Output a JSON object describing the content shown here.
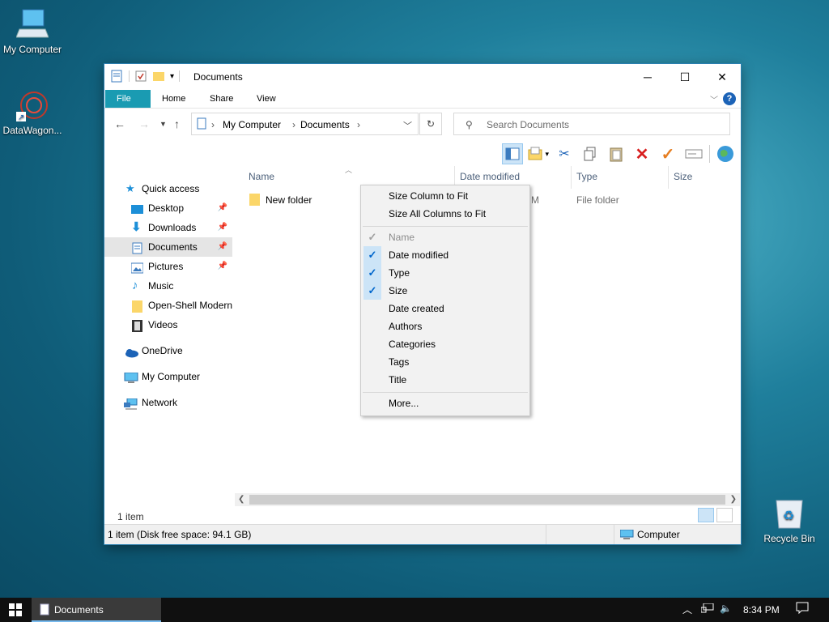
{
  "desktop": {
    "icons": [
      {
        "label": "My Computer"
      },
      {
        "label": "DataWagon..."
      },
      {
        "label": "Recycle Bin"
      }
    ]
  },
  "window": {
    "title": "Documents",
    "ribbon_tabs": [
      "File",
      "Home",
      "Share",
      "View"
    ],
    "help_label": "?",
    "breadcrumb": [
      "My Computer",
      "Documents"
    ],
    "search_placeholder": "Search Documents",
    "columns": {
      "name": "Name",
      "date_modified": "Date modified",
      "type": "Type",
      "size": "Size"
    },
    "files": [
      {
        "name": "New folder",
        "date_fragment": "M",
        "type": "File folder"
      }
    ],
    "nav": {
      "quick_access": "Quick access",
      "items": [
        {
          "label": "Desktop",
          "pinned": true
        },
        {
          "label": "Downloads",
          "pinned": true
        },
        {
          "label": "Documents",
          "pinned": true,
          "active": true
        },
        {
          "label": "Pictures",
          "pinned": true
        },
        {
          "label": "Music",
          "pinned": false
        },
        {
          "label": "Open-Shell Modern",
          "pinned": false
        },
        {
          "label": "Videos",
          "pinned": false
        }
      ],
      "onedrive": "OneDrive",
      "my_computer": "My Computer",
      "network": "Network"
    },
    "item_count": "1 item",
    "status_left": "1 item (Disk free space: 94.1 GB)",
    "status_right": "Computer"
  },
  "context_menu": {
    "items": [
      {
        "label": "Size Column to Fit"
      },
      {
        "label": "Size All Columns to Fit"
      },
      {
        "label": "Name",
        "checked": true,
        "disabled": true
      },
      {
        "label": "Date modified",
        "checked": true
      },
      {
        "label": "Type",
        "checked": true
      },
      {
        "label": "Size",
        "checked": true
      },
      {
        "label": "Date created",
        "checked": false
      },
      {
        "label": "Authors",
        "checked": false
      },
      {
        "label": "Categories",
        "checked": false
      },
      {
        "label": "Tags",
        "checked": false
      },
      {
        "label": "Title",
        "checked": false
      },
      {
        "label": "More..."
      }
    ]
  },
  "taskbar": {
    "task_label": "Documents",
    "time": "8:34 PM"
  },
  "colors": {
    "accent": "#1a9bb2",
    "selection": "#cce4f7",
    "taskbar": "#101010"
  }
}
